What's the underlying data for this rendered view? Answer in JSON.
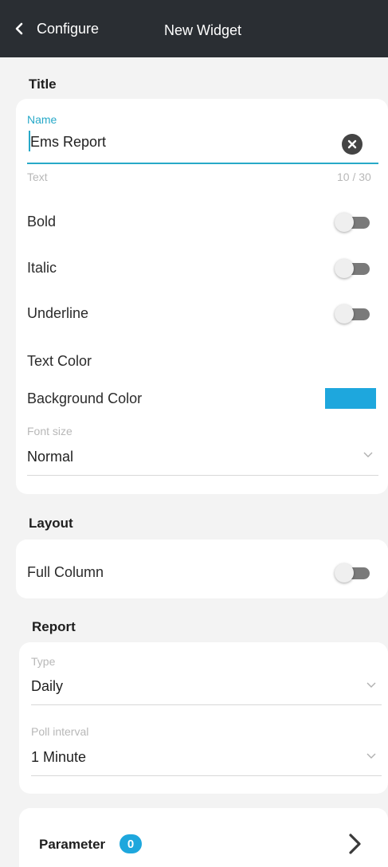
{
  "header": {
    "back_label": "Configure",
    "title": "New Widget"
  },
  "colors": {
    "accent": "#27a9c8",
    "header_bg": "#2a2e33",
    "swatch": "#1ea7dd",
    "badge": "#1ea7dd"
  },
  "title_section": {
    "heading": "Title",
    "name_label": "Name",
    "name_value": "Ems Report",
    "text_hint": "Text",
    "char_count": "10 / 30",
    "bold_label": "Bold",
    "italic_label": "Italic",
    "underline_label": "Underline",
    "text_color_label": "Text Color",
    "background_color_label": "Background Color",
    "font_size_label": "Font size",
    "font_size_value": "Normal",
    "bold_on": false,
    "italic_on": false,
    "underline_on": false
  },
  "layout_section": {
    "heading": "Layout",
    "full_column_label": "Full Column",
    "full_column_on": false
  },
  "report_section": {
    "heading": "Report",
    "type_label": "Type",
    "type_value": "Daily",
    "poll_label": "Poll interval",
    "poll_value": "1 Minute"
  },
  "parameter": {
    "label": "Parameter",
    "count": "0"
  }
}
